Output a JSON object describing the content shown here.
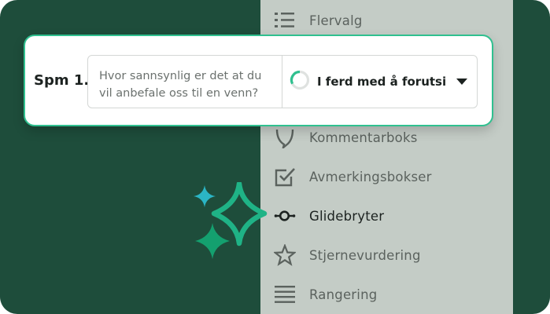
{
  "question": {
    "number_label": "Spm 1.",
    "text": "Hvor sannsynlig er det at du vil anbefale oss til en venn?",
    "type_selected": "I ferd med å forutsi ...",
    "type_icon": "progress-ring-icon",
    "dropdown_icon": "caret-down-icon"
  },
  "menu": {
    "items": [
      {
        "label": "Flervalg",
        "icon": "list-icon"
      },
      {
        "label": "Kommentarboks",
        "icon": "speech-bubble-icon"
      },
      {
        "label": "Avmerkingsbokser",
        "icon": "checkbox-icon"
      },
      {
        "label": "Glidebryter",
        "icon": "slider-icon",
        "active": true
      },
      {
        "label": "Stjernevurdering",
        "icon": "star-icon"
      },
      {
        "label": "Rangering",
        "icon": "ranking-icon"
      }
    ]
  },
  "colors": {
    "background": "#1e4d3b",
    "panel": "#c4ccc6",
    "accent": "#2fc08f",
    "sparkle_teal": "#2bb5c5",
    "sparkle_green": "#14a06f"
  }
}
